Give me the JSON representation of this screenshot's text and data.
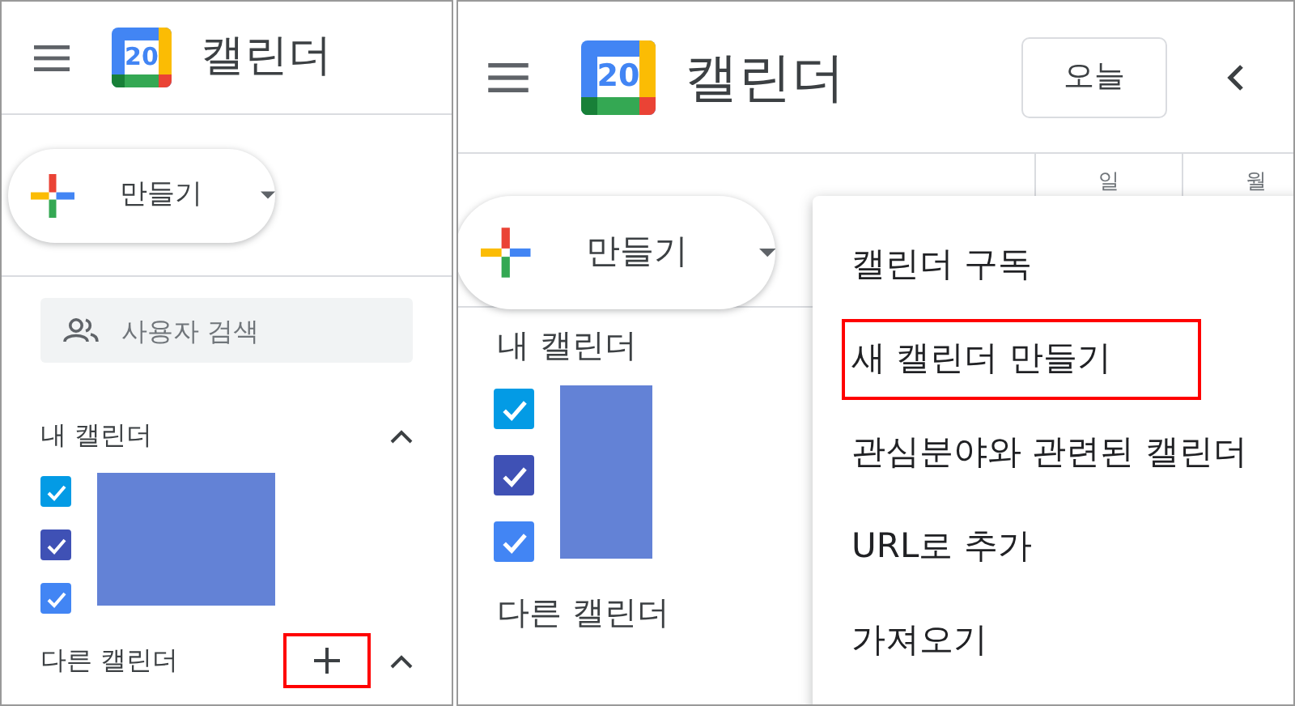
{
  "panels": [
    {
      "app_title": "캘린더",
      "logo_day": "20",
      "create_button": {
        "label": "만들기"
      },
      "search": {
        "placeholder": "사용자 검색"
      },
      "my_calendars": {
        "title": "내 캘린더",
        "expanded": true,
        "items": [
          {
            "checked": true,
            "color": "#039be5"
          },
          {
            "checked": true,
            "color": "#3f51b5"
          },
          {
            "checked": true,
            "color": "#4285f4"
          }
        ]
      },
      "other_calendars": {
        "title": "다른 캘린더",
        "expanded": true,
        "add_button": {
          "highlighted": true
        }
      }
    },
    {
      "app_title": "캘린더",
      "logo_day": "20",
      "today_button": "오늘",
      "day_headers": [
        "일",
        "월"
      ],
      "create_button": {
        "label": "만들기"
      },
      "my_calendars": {
        "title": "내 캘린더",
        "items": [
          {
            "checked": true,
            "color": "#039be5"
          },
          {
            "checked": true,
            "color": "#3f51b5"
          },
          {
            "checked": true,
            "color": "#4285f4"
          }
        ]
      },
      "other_calendars": {
        "title": "다른 캘린더"
      },
      "menu": {
        "items": [
          {
            "label": "캘린더 구독",
            "highlighted": false
          },
          {
            "label": "새 캘린더 만들기",
            "highlighted": true
          },
          {
            "label": "관심분야와 관련된 캘린더",
            "highlighted": false
          },
          {
            "label": "URL로 추가",
            "highlighted": false
          },
          {
            "label": "가져오기",
            "highlighted": false
          }
        ]
      }
    }
  ]
}
